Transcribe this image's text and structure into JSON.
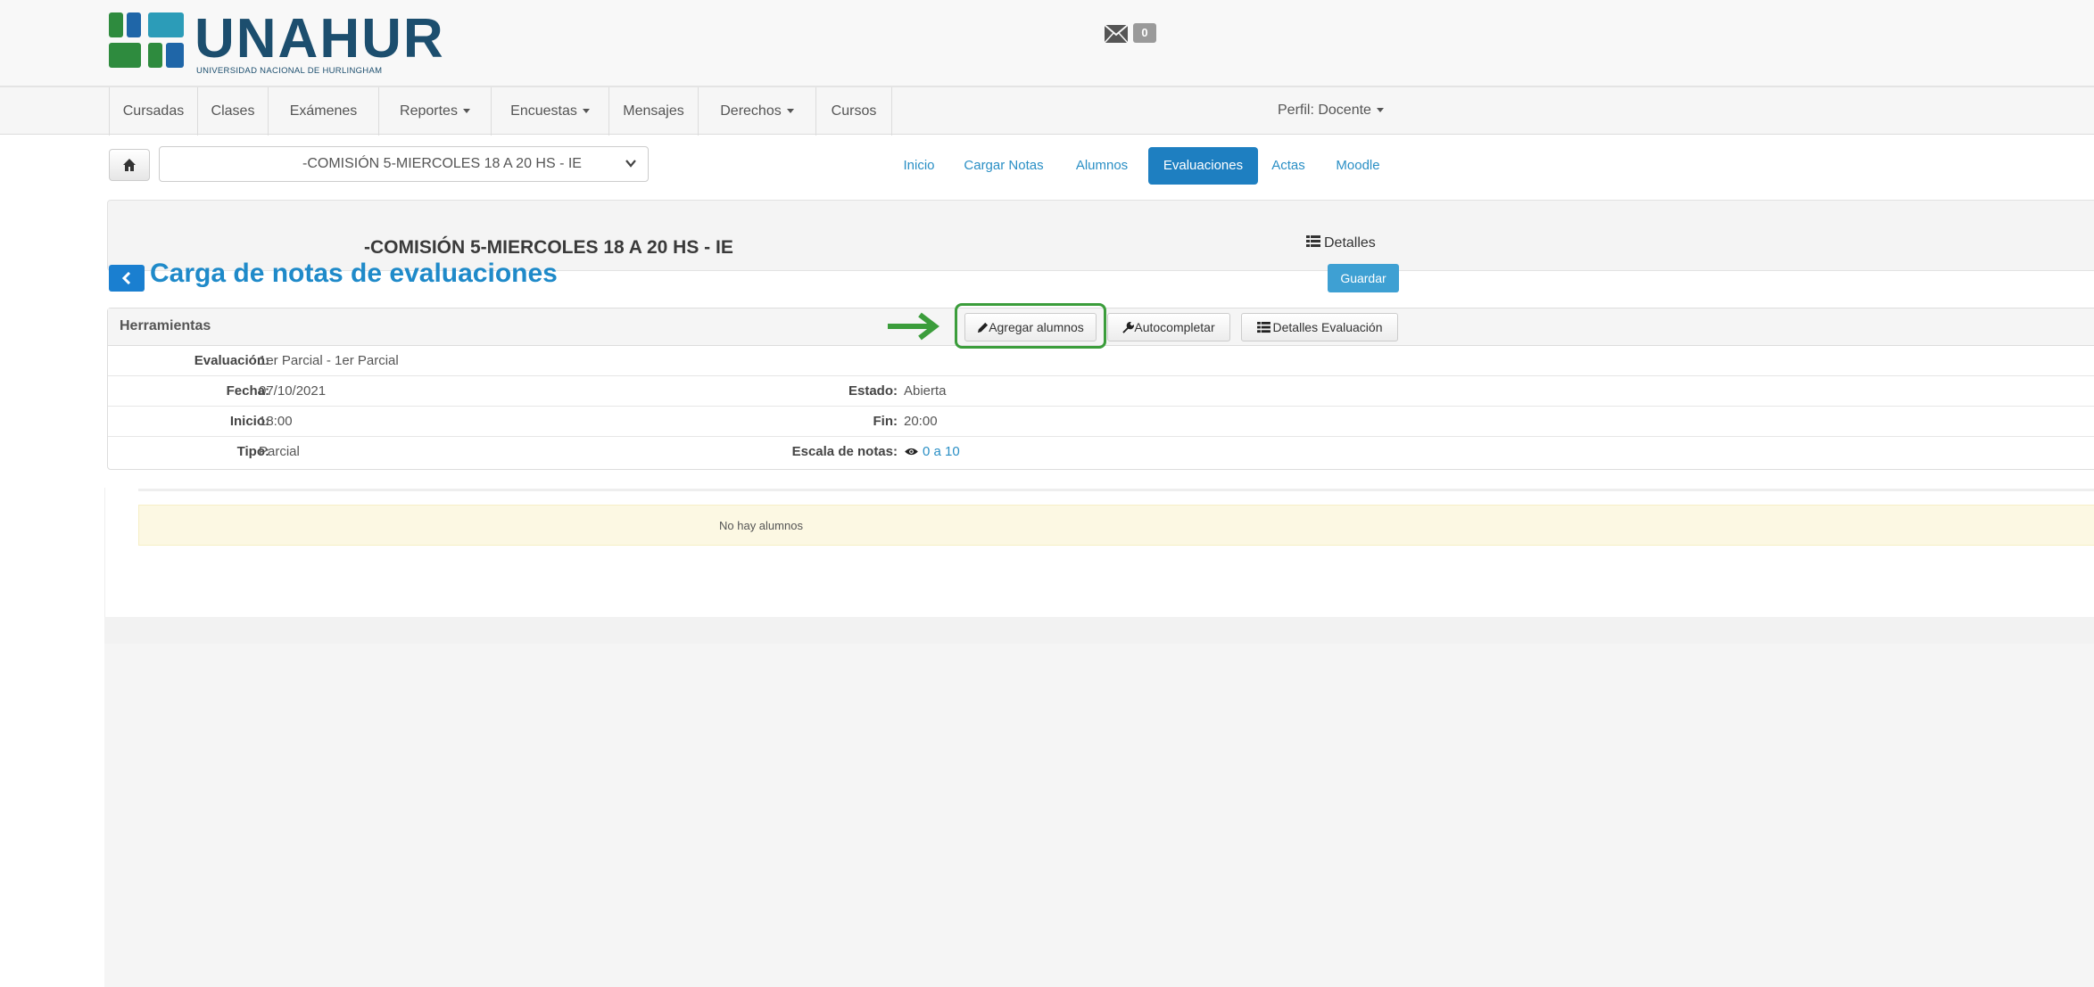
{
  "header": {
    "logo_text": "UNAHUR",
    "logo_subtitle": "UNIVERSIDAD NACIONAL DE HURLINGHAM",
    "logo_colors": [
      "#2e8b3e",
      "#1f66a8",
      "#2c9cb8"
    ],
    "mail_count": "0"
  },
  "navbar": {
    "items": [
      {
        "label": "Cursadas",
        "dropdown": false
      },
      {
        "label": "Clases",
        "dropdown": false
      },
      {
        "label": "Exámenes",
        "dropdown": false
      },
      {
        "label": "Reportes",
        "dropdown": true
      },
      {
        "label": "Encuestas",
        "dropdown": true
      },
      {
        "label": "Mensajes",
        "dropdown": false
      },
      {
        "label": "Derechos",
        "dropdown": true
      },
      {
        "label": "Cursos",
        "dropdown": false
      }
    ],
    "profile": "Perfil: Docente"
  },
  "toolbar": {
    "commission_select": "-COMISIÓN 5-MIERCOLES 18 A 20 HS - IE",
    "tabs": [
      "Inicio",
      "Cargar Notas",
      "Alumnos",
      "Evaluaciones",
      "Actas",
      "Moodle"
    ],
    "active_tab": "Evaluaciones"
  },
  "commission": {
    "title": "-COMISIÓN 5-MIERCOLES 18 A 20 HS - IE",
    "details_label": "Detalles"
  },
  "page": {
    "title": "Carga de notas de evaluaciones",
    "save_label": "Guardar"
  },
  "tools": {
    "title": "Herramientas",
    "buttons": {
      "add_students": "Agregar alumnos",
      "autocomplete": "Autocompletar",
      "eval_details": "Detalles Evaluación"
    }
  },
  "evaluation": {
    "evaluacion_label": "Evaluación:",
    "evaluacion_value": "1er Parcial - 1er Parcial",
    "fecha_label": "Fecha:",
    "fecha_value": "07/10/2021",
    "estado_label": "Estado:",
    "estado_value": "Abierta",
    "inicio_label": "Inicio:",
    "inicio_value": "18:00",
    "fin_label": "Fin:",
    "fin_value": "20:00",
    "tipo_label": "Tipo:",
    "tipo_value": "Parcial",
    "escala_label": "Escala de notas:",
    "escala_value": "0 a 10"
  },
  "students": {
    "empty_message": "No hay alumnos"
  },
  "colors": {
    "primary": "#1e7fc1",
    "link": "#2a8fc5",
    "title": "#1f8ac9",
    "highlight": "#3b9d3b",
    "alert_bg": "#fcf8e3"
  }
}
